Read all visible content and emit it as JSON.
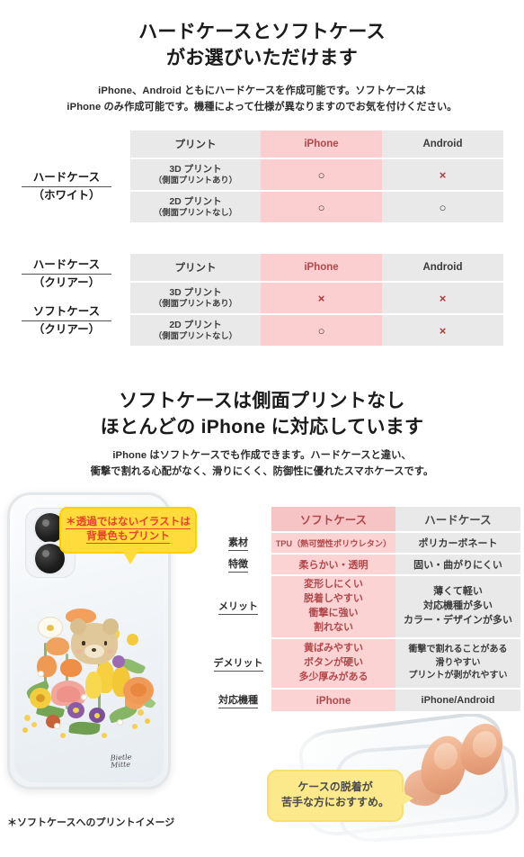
{
  "section1": {
    "heading_line1": "ハードケースとソフトケース",
    "heading_line2": "がお選びいただけます",
    "lead_line1": "iPhone、Android ともにハードケースを作成可能です。ソフトケースは",
    "lead_line2": "iPhone のみ作成可能です。機種によって仕様が異なりますのでお気を付けください。"
  },
  "table1": {
    "side_label_main": "ハードケース",
    "side_label_sub": "（ホワイト）",
    "headers": [
      "プリント",
      "iPhone",
      "Android"
    ],
    "rows": [
      {
        "name": "3D プリント",
        "note": "（側面プリントあり）",
        "iphone": "○",
        "android": "×"
      },
      {
        "name": "2D プリント",
        "note": "（側面プリントなし）",
        "iphone": "○",
        "android": "○"
      }
    ]
  },
  "table2": {
    "side_label_main_1": "ハードケース",
    "side_label_sub_1": "（クリアー）",
    "side_label_main_2": "ソフトケース",
    "side_label_sub_2": "（クリアー）",
    "headers": [
      "プリント",
      "iPhone",
      "Android"
    ],
    "rows": [
      {
        "name": "3D プリント",
        "note": "（側面プリントあり）",
        "iphone": "×",
        "android": "×"
      },
      {
        "name": "2D プリント",
        "note": "（側面プリントなし）",
        "iphone": "○",
        "android": "×"
      }
    ]
  },
  "section2": {
    "heading_line1": "ソフトケースは側面プリントなし",
    "heading_line2": "ほとんどの iPhone に対応しています",
    "lead_line1": "iPhone はソフトケースでも作成できます。ハードケースと違い、",
    "lead_line2": "衝撃で割れる心配がなく、滑りにくく、防御性に優れたスマホケースです。"
  },
  "comparison": {
    "headers": [
      "",
      "ソフトケース",
      "ハードケース"
    ],
    "rows": [
      {
        "label": "素材",
        "soft": [
          "TPU（熱可塑性ポリウレタン）"
        ],
        "hard": [
          "ポリカーボネート"
        ]
      },
      {
        "label": "特徴",
        "soft": [
          "柔らかい・透明"
        ],
        "hard": [
          "固い・曲がりにくい"
        ]
      },
      {
        "label": "メリット",
        "soft": [
          "変形しにくい",
          "脱着しやすい",
          "衝撃に強い",
          "割れない"
        ],
        "hard": [
          "薄くて軽い",
          "対応機種が多い",
          "カラー・デザインが多い"
        ]
      },
      {
        "label": "デメリット",
        "soft": [
          "黄ばみやすい",
          "ボタンが硬い",
          "多少厚みがある"
        ],
        "hard": [
          "衝撃で割れることがある",
          "滑りやすい",
          "プリントが剥がれやすい"
        ]
      },
      {
        "label": "対応機種",
        "soft": [
          "iPhone"
        ],
        "hard": [
          "iPhone/Android"
        ]
      }
    ]
  },
  "callouts": {
    "bubble_top_line1": "＊透過ではないイラストは",
    "bubble_top_line2": "背景色もプリント",
    "bubble_bottom_line1": "ケースの脱着が",
    "bubble_bottom_line2": "苦手な方におすすめ。"
  },
  "phone_art": {
    "brand_line1": "Bietle",
    "brand_line2": "Mitte"
  },
  "footnote": "＊ソフトケースへのプリントイメージ",
  "colors": {
    "pink_header": "#f6c4c4",
    "pink_cell": "#fbd3d3",
    "pink_upper": "#fbcfcf",
    "grey_cell": "#e9e9e9",
    "accent_red": "#b4474b",
    "bubble_yellow": "#ffdc3c",
    "bubble_cream": "#fbe98c",
    "callout_red": "#e8422a",
    "text": "#231f20"
  }
}
